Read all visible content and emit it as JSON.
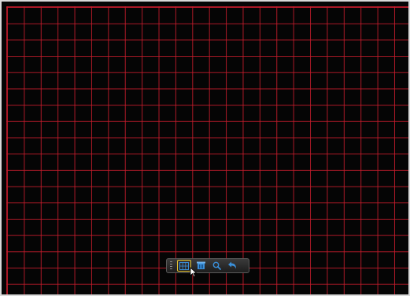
{
  "screen": {
    "grid_line_color": "#c81c2c",
    "background_color": "#050505"
  },
  "toolbar": {
    "buttons": [
      {
        "icon": "grid-icon",
        "selected": true
      },
      {
        "icon": "clear-icon",
        "selected": false
      },
      {
        "icon": "search-icon",
        "selected": false
      },
      {
        "icon": "back-icon",
        "selected": false
      }
    ],
    "selected_border_color": "#e7c531",
    "icon_color": "#3a8fd9"
  }
}
